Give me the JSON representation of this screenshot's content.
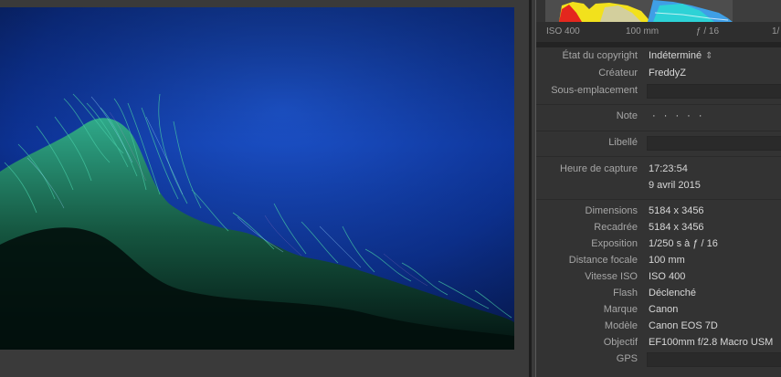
{
  "histogram": {
    "iso": "ISO 400",
    "focal": "100 mm",
    "aperture": "ƒ / 16",
    "extra": "1/"
  },
  "metadata": {
    "copyright_status": {
      "label": "État du copyright",
      "value": "Indéterminé"
    },
    "creator": {
      "label": "Créateur",
      "value": "FreddyZ"
    },
    "sublocation": {
      "label": "Sous-emplacement",
      "value": ""
    },
    "rating": {
      "label": "Note",
      "value": "· · · · ·"
    },
    "caption": {
      "label": "Libellé",
      "value": ""
    },
    "capture_time": {
      "label": "Heure de capture",
      "time": "17:23:54",
      "date": "9 avril 2015"
    },
    "dimensions": {
      "label": "Dimensions",
      "value": "5184 x 3456"
    },
    "cropped": {
      "label": "Recadrée",
      "value": "5184 x 3456"
    },
    "exposure": {
      "label": "Exposition",
      "value": "1/250 s à ƒ / 16"
    },
    "focal_length": {
      "label": "Distance focale",
      "value": "100 mm"
    },
    "iso": {
      "label": "Vitesse ISO",
      "value": "ISO 400"
    },
    "flash": {
      "label": "Flash",
      "value": "Déclenché"
    },
    "make": {
      "label": "Marque",
      "value": "Canon"
    },
    "model": {
      "label": "Modèle",
      "value": "Canon EOS 7D"
    },
    "lens": {
      "label": "Objectif",
      "value": "EF100mm f/2.8 Macro USM"
    },
    "gps": {
      "label": "GPS",
      "value": ""
    }
  }
}
